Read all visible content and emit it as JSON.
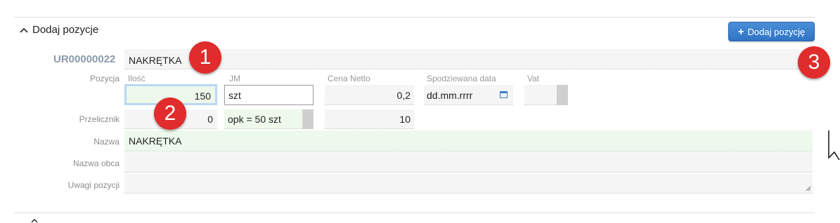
{
  "section": {
    "title": "Dodaj pozycje"
  },
  "add_button": {
    "icon": "plus-icon",
    "label": "Dodaj pozycję",
    "color": "#3a7fcd"
  },
  "product": {
    "code": "UR00000022",
    "name": "NAKRĘTKA"
  },
  "row_labels": {
    "position": "Pozycja",
    "converter": "Przelicznik",
    "name": "Nazwa",
    "foreign_name": "Nazwa obca",
    "notes": "Uwagi pozycji"
  },
  "columns": {
    "quantity": "Ilość",
    "unit": "JM",
    "net_price": "Cena Netto",
    "expected_date": "Spodziewana data",
    "vat": "Vat"
  },
  "position_row": {
    "quantity": "150",
    "unit": "szt",
    "net_price": "0,2",
    "expected_date_placeholder": "dd.mm.rrrr",
    "vat": ""
  },
  "converter_row": {
    "value": "0",
    "package": "opk = 50 szt",
    "price": "10"
  },
  "name_value": "NAKRĘTKA",
  "foreign_name_value": "",
  "notes_value": "",
  "callouts": [
    "1",
    "2",
    "3"
  ],
  "colors": {
    "callout": "#e02c2c",
    "accent": "#3a7fcd",
    "valid_field": "#eef9ec"
  }
}
